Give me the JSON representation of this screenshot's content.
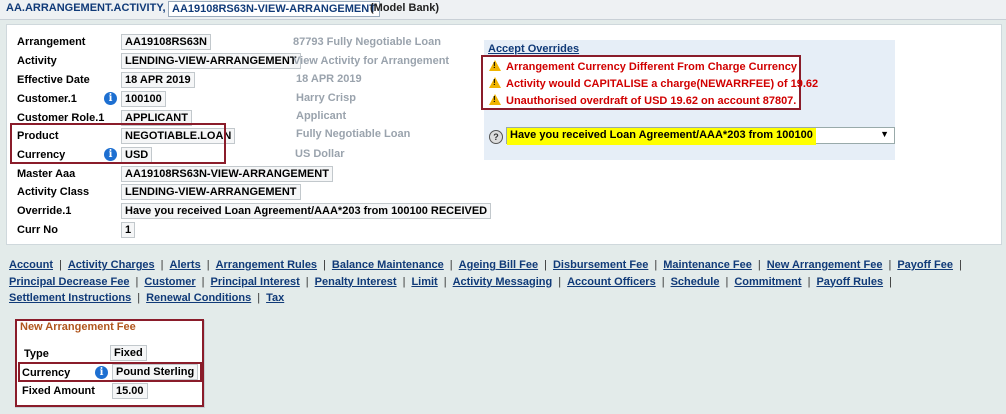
{
  "header": {
    "app_name": "AA.ARRANGEMENT.ACTIVITY,",
    "transaction_id": "AA19108RS63N-VIEW-ARRANGEMENT",
    "company": "(Model Bank)"
  },
  "fields": {
    "arrangement": {
      "label": "Arrangement",
      "value": "AA19108RS63N",
      "enrichment": "87793 Fully Negotiable Loan"
    },
    "activity": {
      "label": "Activity",
      "value": "LENDING-VIEW-ARRANGEMENT",
      "enrichment": "View Activity for Arrangement"
    },
    "effective_date": {
      "label": "Effective Date",
      "value": "18 APR 2019",
      "enrichment": "18 APR 2019"
    },
    "customer1": {
      "label": "Customer.1",
      "value": "100100",
      "enrichment": "Harry Crisp"
    },
    "customer_role1": {
      "label": "Customer Role.1",
      "value": "APPLICANT",
      "enrichment": "Applicant"
    },
    "product": {
      "label": "Product",
      "value": "NEGOTIABLE.LOAN",
      "enrichment": "Fully Negotiable Loan"
    },
    "currency": {
      "label": "Currency",
      "value": "USD",
      "enrichment": "US Dollar"
    },
    "master_aaa": {
      "label": "Master Aaa",
      "value": "AA19108RS63N-VIEW-ARRANGEMENT"
    },
    "activity_class": {
      "label": "Activity Class",
      "value": "LENDING-VIEW-ARRANGEMENT"
    },
    "override1": {
      "label": "Override.1",
      "value": "Have you received Loan Agreement/AAA*203 from 100100 RECEIVED"
    },
    "curr_no": {
      "label": "Curr No",
      "value": "1"
    }
  },
  "overrides": {
    "title": "Accept Overrides",
    "warnings": [
      "Arrangement Currency Different From Charge Currency",
      "Activity would CAPITALISE a charge(NEWARRFEE) of 19.62",
      "Unauthorised overdraft of USD 19.62 on account 87807."
    ],
    "question": "Have you received Loan Agreement/AAA*203 from 100100"
  },
  "tabs": [
    "Account",
    "Activity Charges",
    "Alerts",
    "Arrangement Rules",
    "Balance Maintenance",
    "Ageing Bill Fee",
    "Disbursement Fee",
    "Maintenance Fee",
    "New Arrangement Fee",
    "Payoff Fee",
    "Principal Decrease Fee",
    "Customer",
    "Principal Interest",
    "Penalty Interest",
    "Limit",
    "Activity Messaging",
    "Account Officers",
    "Schedule",
    "Commitment",
    "Payoff Rules",
    "Settlement Instructions",
    "Renewal Conditions",
    "Tax"
  ],
  "fee": {
    "legend": "New Arrangement Fee",
    "type": {
      "label": "Type",
      "value": "Fixed"
    },
    "currency": {
      "label": "Currency",
      "value": "Pound Sterling"
    },
    "fixed_amount": {
      "label": "Fixed Amount",
      "value": "15.00"
    }
  },
  "colors": {
    "warning_text": "#d10000",
    "highlight_box": "#8a1c2a",
    "link": "#103a78",
    "question_bg": "#ffff00"
  }
}
